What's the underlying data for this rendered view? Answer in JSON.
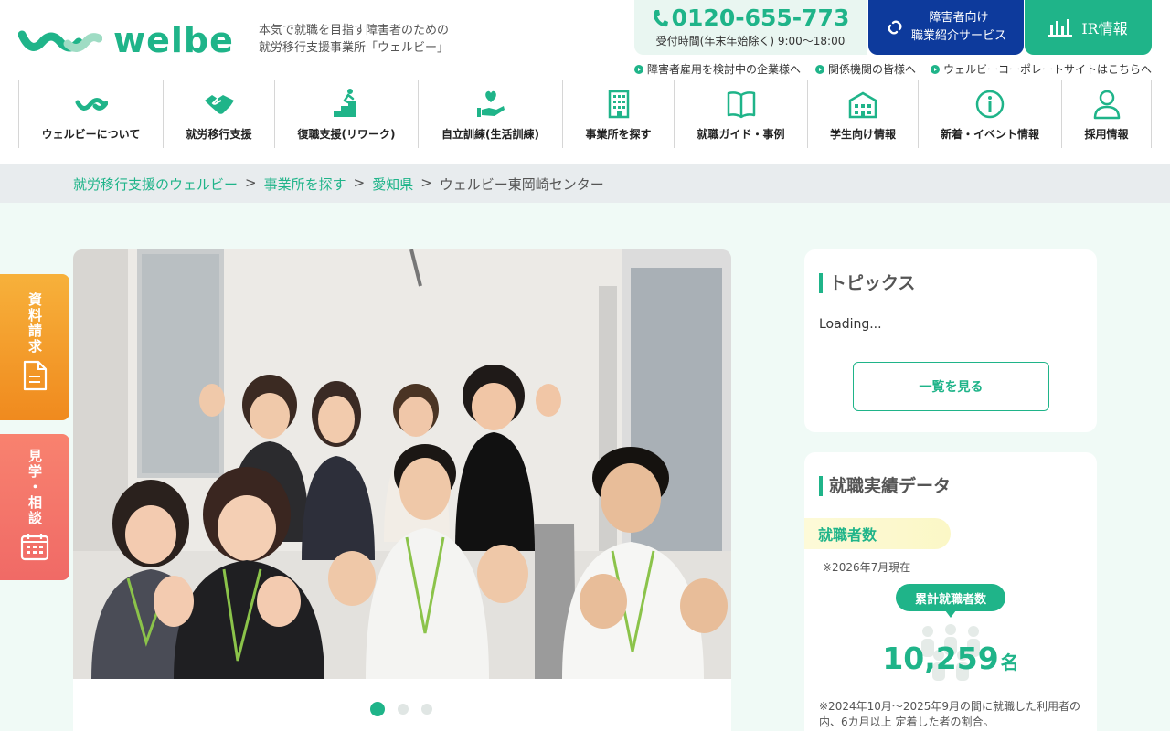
{
  "header": {
    "brand": "welbe",
    "tagline_1": "本気で就職を目指す障害者のための",
    "tagline_2": "就労移行支援事業所「ウェルビー」",
    "phone": "0120-655-773",
    "phone_hours": "受付時間(年末年始除く) 9:00〜18:00",
    "agent_btn_1": "障害者向け",
    "agent_btn_2": "職業紹介サービス",
    "ir_btn": "IR情報",
    "sublinks": [
      "障害者雇用を検討中の企業様へ",
      "関係機関の皆様へ",
      "ウェルビーコーポレートサイトはこちらへ"
    ]
  },
  "nav": [
    {
      "label": "ウェルビーについて",
      "icon": "welbe-wave-icon"
    },
    {
      "label": "就労移行支援",
      "icon": "handshake-icon"
    },
    {
      "label": "復職支援(リワーク)",
      "icon": "stairs-climb-icon"
    },
    {
      "label": "自立訓練(生活訓練)",
      "icon": "heart-hand-icon"
    },
    {
      "label": "事業所を探す",
      "icon": "building-icon"
    },
    {
      "label": "就職ガイド・事例",
      "icon": "book-icon"
    },
    {
      "label": "学生向け情報",
      "icon": "school-icon"
    },
    {
      "label": "新着・イベント情報",
      "icon": "info-icon"
    },
    {
      "label": "採用情報",
      "icon": "person-icon"
    }
  ],
  "breadcrumb": {
    "items": [
      "就労移行支援のウェルビー",
      "事業所を探す",
      "愛知県"
    ],
    "current": "ウェルビー東岡崎センター",
    "separator": ">"
  },
  "side_tabs": {
    "request": "資料請求",
    "visit": "見学・相談"
  },
  "topics": {
    "title": "トピックス",
    "loading": "Loading...",
    "list_btn": "一覧を見る"
  },
  "employment": {
    "title": "就職実績データ",
    "hires_label": "就職者数",
    "as_of": "※2026年7月現在",
    "total_label": "累計就職者数",
    "total_value": "10,259",
    "total_unit": "名",
    "note": "※2024年10月〜2025年9月の間に就職した利用者の内、6カ月以上 定着した者の割合。"
  },
  "colors": {
    "brand_green": "#1fb489",
    "navy": "#0d3a9c",
    "orange": "#f08a1e",
    "pink": "#f06a66"
  }
}
